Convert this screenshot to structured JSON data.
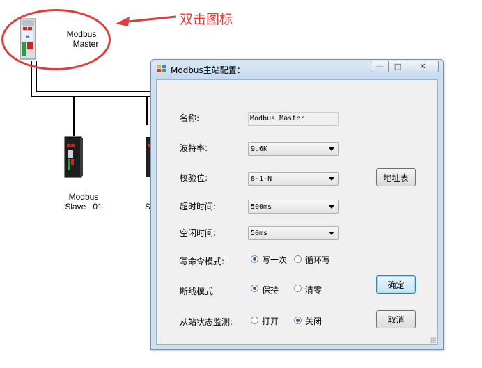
{
  "annotation": {
    "text": "双击图标",
    "color": "#e23b3b"
  },
  "canvas": {
    "devices": [
      {
        "name_line1": "Modbus",
        "name_line2": "Master"
      },
      {
        "name_line1": "Modbus",
        "name_line2": "Slave   01"
      },
      {
        "name_line1": "S"
      }
    ]
  },
  "dialog": {
    "title": "Modbus主站配置：",
    "fields": {
      "name_label": "名称:",
      "name_value": "Modbus Master",
      "baud_label": "波特率:",
      "baud_value": "9.6K",
      "parity_label": "校验位:",
      "parity_value": "8-1-N",
      "timeout_label": "超时时间:",
      "timeout_value": "500ms",
      "idle_label": "空闲时间:",
      "idle_value": "50ms",
      "write_mode_label": "写命令模式:",
      "write_once": "写一次",
      "write_loop": "循环写",
      "write_mode_selected": "写一次",
      "disconnect_label": "断线模式",
      "keep": "保持",
      "clear": "清零",
      "disconnect_selected": "保持",
      "monitor_label": "从站状态监测:",
      "open": "打开",
      "close": "关闭",
      "monitor_selected": "关闭"
    },
    "buttons": {
      "address_table": "地址表",
      "ok": "确定",
      "cancel": "取消"
    },
    "window_controls": {
      "minimize": "—",
      "maximize": "□",
      "close": "✕"
    }
  },
  "icons": [
    "plc-master-icon",
    "plc-slave-icon",
    "arrow-icon",
    "app-icon",
    "radio-icon"
  ],
  "colors": {
    "accent": "#e23b3b",
    "dialog_frame": "#cfdff0",
    "client": "#f0f0f0"
  }
}
